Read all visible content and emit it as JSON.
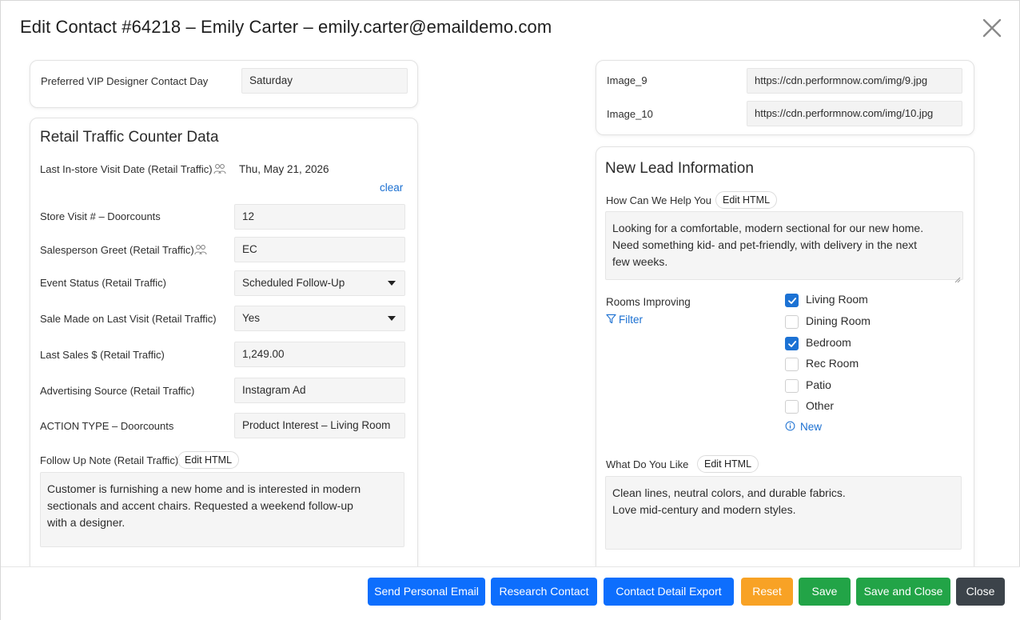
{
  "modal": {
    "title": "Edit Contact #64218 – Emily Carter – emily.carter@emaildemo.com"
  },
  "vip_card": {
    "label": "Preferred VIP Designer Contact Day",
    "value": "Saturday"
  },
  "retail_traffic": {
    "title": "Retail Traffic Counter Data",
    "last_visit_label": "Last In-store Visit Date (Retail Traffic)",
    "last_visit_value": "Thu, May 21, 2026",
    "clear_label": "clear",
    "store_visit_label": "Store Visit # – Doorcounts",
    "store_visit_value": "12",
    "greet_label": "Salesperson Greet (Retail Traffic)",
    "greet_value": "EC",
    "event_status_label": "Event Status (Retail Traffic)",
    "event_status_value": "Scheduled Follow-Up",
    "sale_made_label": "Sale Made on Last Visit (Retail Traffic)",
    "sale_made_value": "Yes",
    "last_sales_label": "Last Sales $ (Retail Traffic)",
    "last_sales_value": "1,249.00",
    "adv_source_label": "Advertising Source (Retail Traffic)",
    "adv_source_value": "Instagram Ad",
    "action_type_label": "ACTION TYPE – Doorcounts",
    "action_type_value": "Product Interest – Living Room",
    "follow_up_label": "Follow Up Note (Retail Traffic)",
    "edit_html_label": "Edit HTML",
    "follow_up_lines": [
      "Customer is furnishing a new home and is interested in modern",
      "sectionals and accent chairs. Requested a weekend follow-up",
      "with a designer."
    ]
  },
  "images_card": {
    "image9_label": "Image_9",
    "image9_value": "https://cdn.performnow.com/img/9.jpg",
    "image10_label": "Image_10",
    "image10_value": "https://cdn.performnow.com/img/10.jpg"
  },
  "new_lead": {
    "title": "New Lead Information",
    "help_label": "How Can We Help You",
    "edit_html_label": "Edit HTML",
    "help_lines": [
      "Looking for a comfortable, modern sectional for our new home.",
      "Need something kid- and pet-friendly, with delivery in the next",
      "few weeks."
    ],
    "rooms_label": "Rooms Improving",
    "filter_label": "Filter",
    "rooms": [
      {
        "label": "Living Room",
        "checked": true
      },
      {
        "label": "Dining Room",
        "checked": false
      },
      {
        "label": "Bedroom",
        "checked": true
      },
      {
        "label": "Rec Room",
        "checked": false
      },
      {
        "label": "Patio",
        "checked": false
      },
      {
        "label": "Other",
        "checked": false
      }
    ],
    "new_label": "New",
    "like_label": "What Do You Like",
    "like_lines": [
      "Clean lines, neutral colors, and durable fabrics.",
      "Love mid-century and modern styles."
    ]
  },
  "footer": {
    "send_email": "Send Personal Email",
    "research": "Research Contact",
    "export": "Contact Detail Export",
    "reset": "Reset",
    "save": "Save",
    "save_close": "Save and Close",
    "close": "Close"
  },
  "colors": {
    "primary_blue": "#0d6efd",
    "reset_orange": "#f8a225",
    "save_green": "#22a447",
    "close_dark": "#3c434a",
    "link_blue": "#1a6fd1",
    "checkbox_blue": "#1c72d4"
  }
}
